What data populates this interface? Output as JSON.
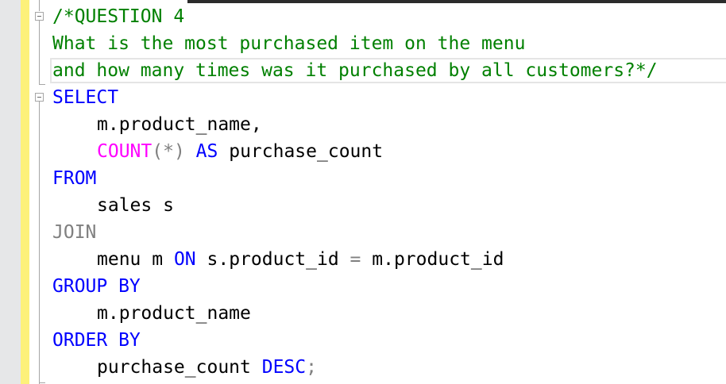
{
  "editor": {
    "colors": {
      "comment": "#008000",
      "keyword": "#0000ff",
      "function": "#ff00ff",
      "operator": "#808080",
      "identifier": "#000000"
    },
    "comment_lines": [
      "/*QUESTION 4",
      "What is the most purchased item on the menu",
      "and how many times was it purchased by all customers?*/"
    ],
    "sql": {
      "select_kw": "SELECT",
      "col1": "m.product_name,",
      "count_fn": "COUNT",
      "count_args": "(*)",
      "as_kw": "AS",
      "alias": "purchase_count",
      "from_kw": "FROM",
      "from_table": "sales s",
      "join_kw": "JOIN",
      "join_table": "menu m",
      "on_kw": "ON",
      "on_left": "s.product_id",
      "eq": "=",
      "on_right": "m.product_id",
      "group_kw": "GROUP BY",
      "group_col": "m.product_name",
      "order_kw": "ORDER BY",
      "order_col": "purchase_count",
      "desc_kw": "DESC",
      "semicolon": ";"
    }
  }
}
